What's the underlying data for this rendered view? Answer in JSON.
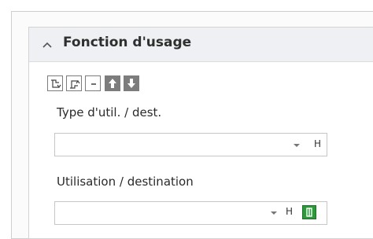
{
  "section": {
    "title": "Fonction d'usage",
    "expanded": true
  },
  "toolbar": {
    "icons": [
      "expand-all-icon",
      "collapse-all-icon",
      "remove-icon",
      "move-up-icon",
      "move-down-icon"
    ],
    "remove_glyph": "-"
  },
  "fields": [
    {
      "label": "Type d'util. / dest.",
      "value": "",
      "flag": "H"
    },
    {
      "label": "Utilisation / destination",
      "value": "",
      "flag": "H"
    }
  ],
  "colors": {
    "header_bg": "#eef0f3",
    "accent_green": "#2c9a3a",
    "tool_gray": "#7d7d7d"
  }
}
